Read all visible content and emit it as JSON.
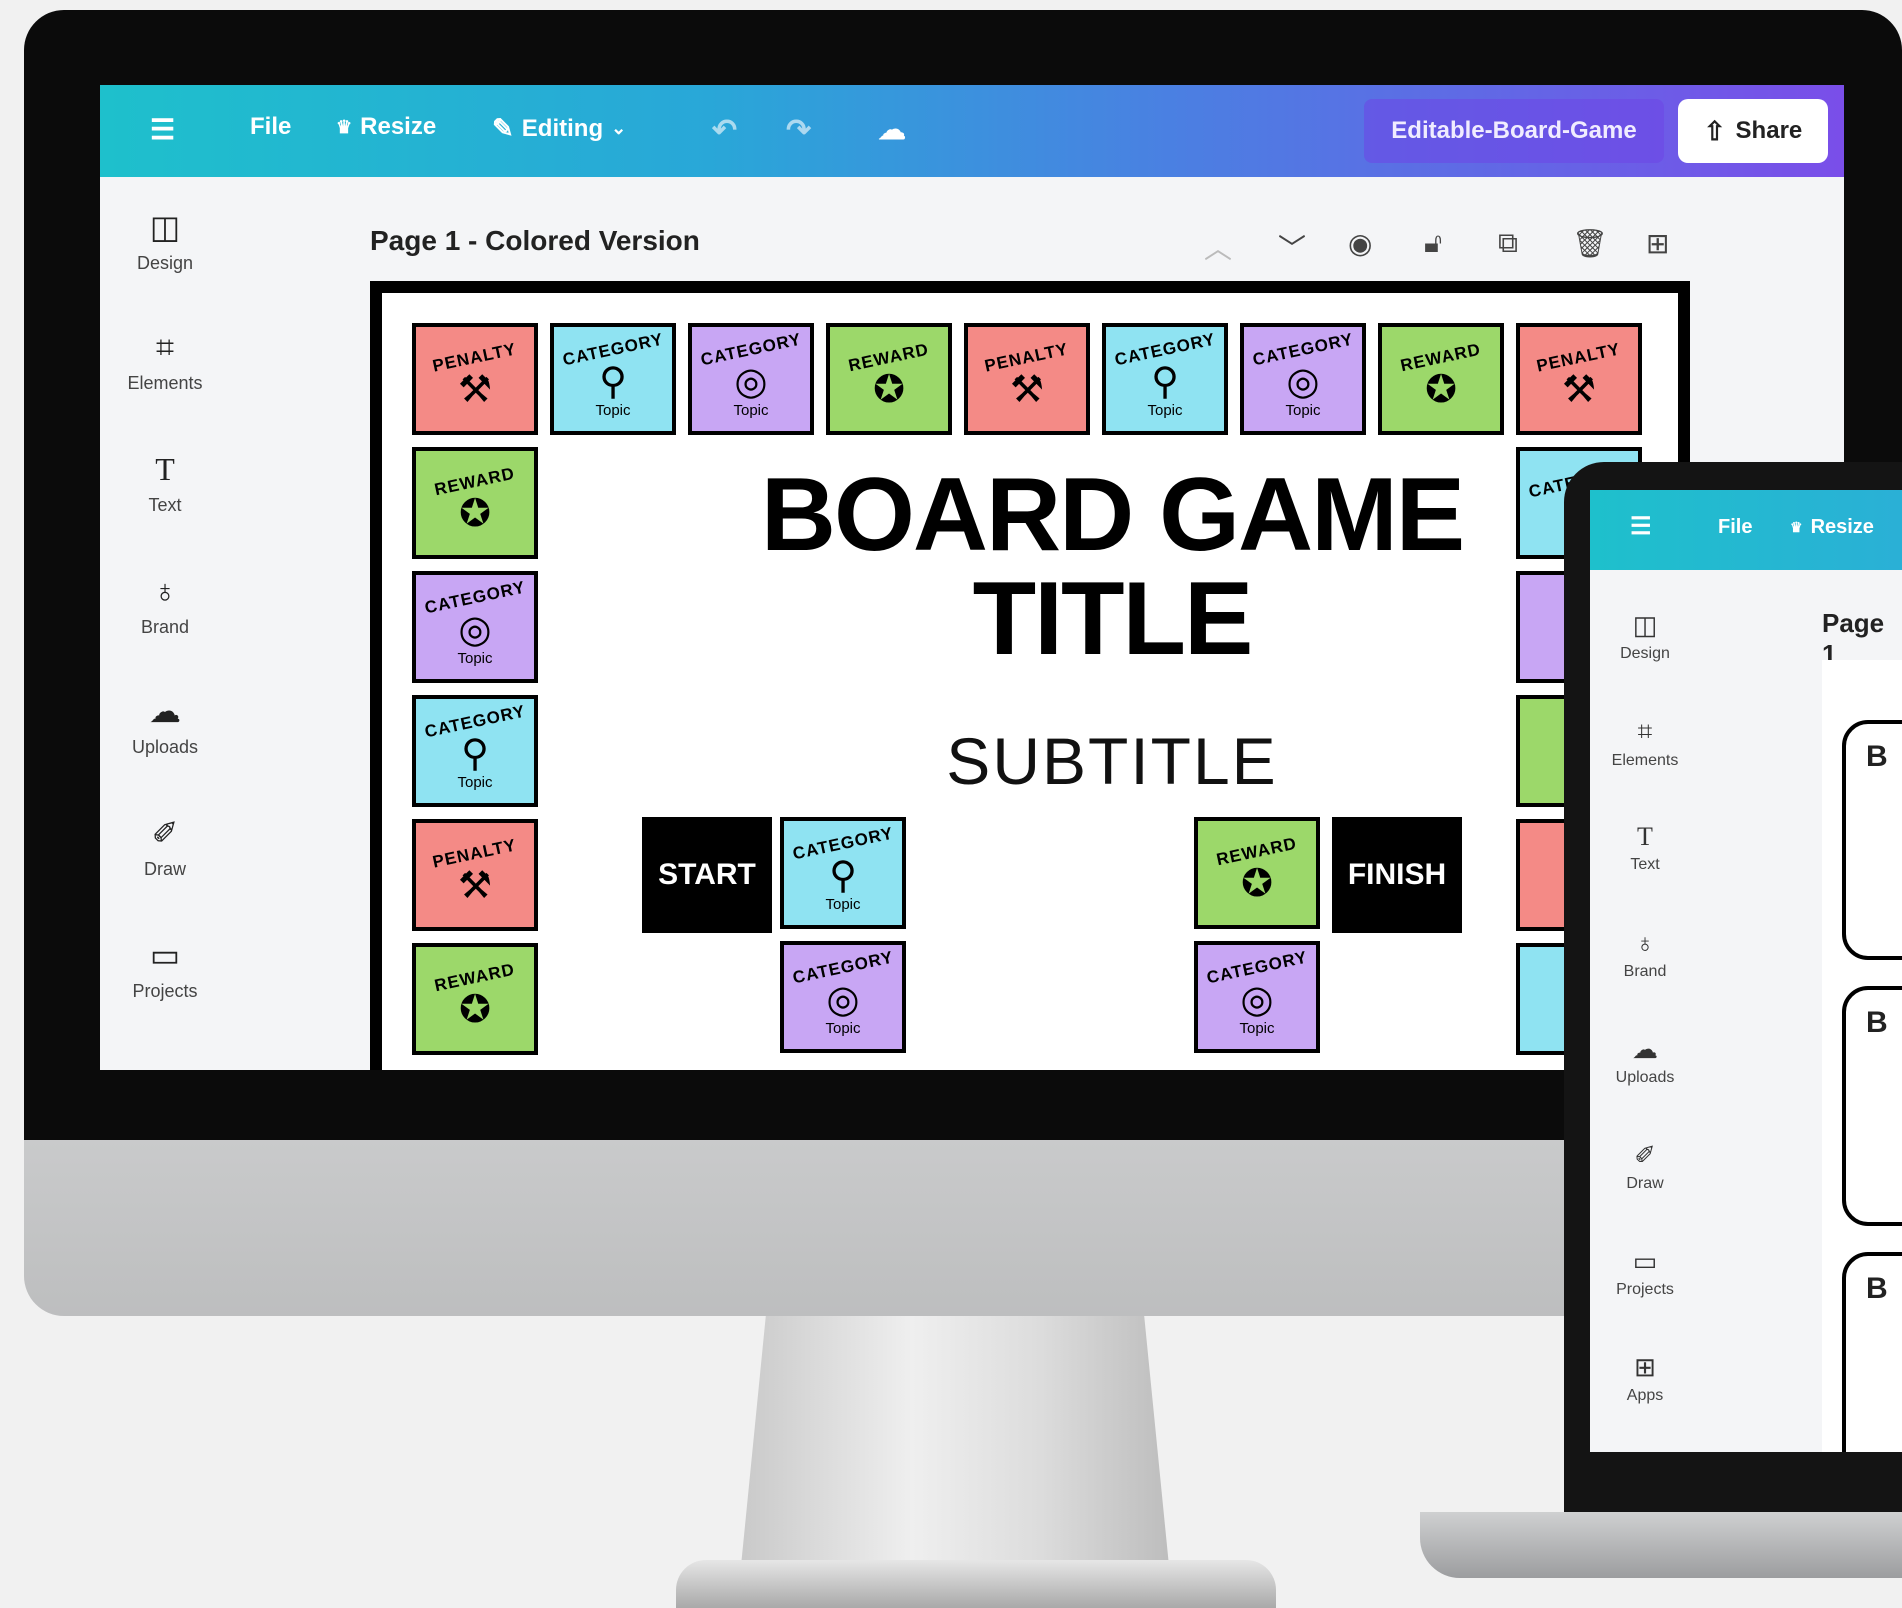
{
  "topbar": {
    "menu_icon": "hamburger-icon",
    "file": "File",
    "resize": "Resize",
    "editing": "Editing",
    "doc_name": "Editable-Board-Game",
    "share": "Share"
  },
  "sidebar": {
    "items": [
      {
        "label": "Design",
        "icon": "layout-icon"
      },
      {
        "label": "Elements",
        "icon": "shapes-icon"
      },
      {
        "label": "Text",
        "icon": "text-icon"
      },
      {
        "label": "Brand",
        "icon": "brand-icon"
      },
      {
        "label": "Uploads",
        "icon": "cloud-upload-icon"
      },
      {
        "label": "Draw",
        "icon": "pen-icon"
      },
      {
        "label": "Projects",
        "icon": "folder-icon"
      }
    ]
  },
  "page": {
    "title": "Page 1 - Colored Version"
  },
  "board": {
    "title_line1": "BOARD GAME",
    "title_line2": "TITLE",
    "subtitle": "SUBTITLE",
    "start": "START",
    "finish": "FINISH",
    "tile_words": {
      "penalty": "PENALTY",
      "category": "CATEGORY",
      "reward": "REWARD",
      "topic": "Topic"
    },
    "colors": {
      "penalty": "#f48a86",
      "category_blue": "#8fe3f2",
      "category_purple": "#c8a6f4",
      "reward": "#9cd86a"
    }
  },
  "laptop": {
    "topbar": {
      "file": "File",
      "resize": "Resize"
    },
    "page_title": "Page 1",
    "card_letter": "B",
    "sidebar": [
      {
        "label": "Design"
      },
      {
        "label": "Elements"
      },
      {
        "label": "Text"
      },
      {
        "label": "Brand"
      },
      {
        "label": "Uploads"
      },
      {
        "label": "Draw"
      },
      {
        "label": "Projects"
      },
      {
        "label": "Apps"
      }
    ]
  }
}
